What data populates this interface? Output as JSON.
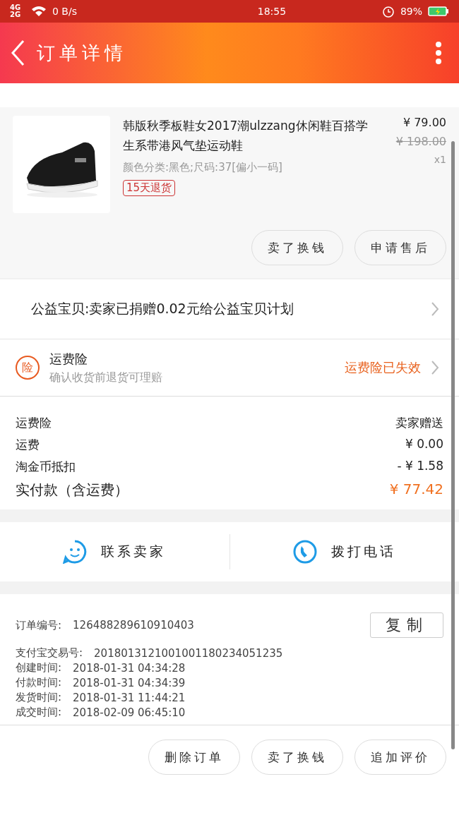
{
  "status_bar": {
    "network": "4G 2G",
    "speed": "0 B/s",
    "time": "18:55",
    "battery": "89%"
  },
  "header": {
    "title": "订单详情"
  },
  "product": {
    "title": "韩版秋季板鞋女2017潮ulzzang休闲鞋百搭学生系带港风气垫运动鞋",
    "price": "¥ 79.00",
    "original_price": "¥ 198.00",
    "sku": "颜色分类:黑色;尺码:37[偏小一码]",
    "quantity": "x1",
    "tag": "15天退货",
    "buttons": [
      "卖了换钱",
      "申请售后"
    ]
  },
  "charity": {
    "text": "公益宝贝:卖家已捐赠0.02元给公益宝贝计划"
  },
  "insurance": {
    "badge": "险",
    "title": "运费险",
    "subtitle": "确认收货前退货可理赔",
    "status": "运费险已失效"
  },
  "costs": [
    {
      "label": "运费险",
      "value": "卖家赠送",
      "kind": "normal"
    },
    {
      "label": "运费",
      "value": "¥ 0.00",
      "kind": "normal"
    },
    {
      "label": "淘金币抵扣",
      "value": "- ¥ 1.58",
      "kind": "normal"
    },
    {
      "label": "实付款（含运费）",
      "value": "¥ 77.42",
      "kind": "total"
    }
  ],
  "contact": [
    {
      "label": "联系卖家",
      "kind": "chat"
    },
    {
      "label": "拨打电话",
      "kind": "phone"
    }
  ],
  "order_info": {
    "copy_button": "复制",
    "rows": [
      {
        "label": "订单编号:",
        "value": "126488289610910403"
      },
      {
        "label": "支付宝交易号:",
        "value": "2018013121001001180234051235"
      },
      {
        "label": "创建时间:",
        "value": "2018-01-31 04:34:28"
      },
      {
        "label": "付款时间:",
        "value": "2018-01-31 04:34:39"
      },
      {
        "label": "发货时间:",
        "value": "2018-01-31 11:44:21"
      },
      {
        "label": "成交时间:",
        "value": "2018-02-09 06:45:10"
      }
    ]
  },
  "bottom_buttons": [
    "删除订单",
    "卖了换钱",
    "追加评价"
  ]
}
